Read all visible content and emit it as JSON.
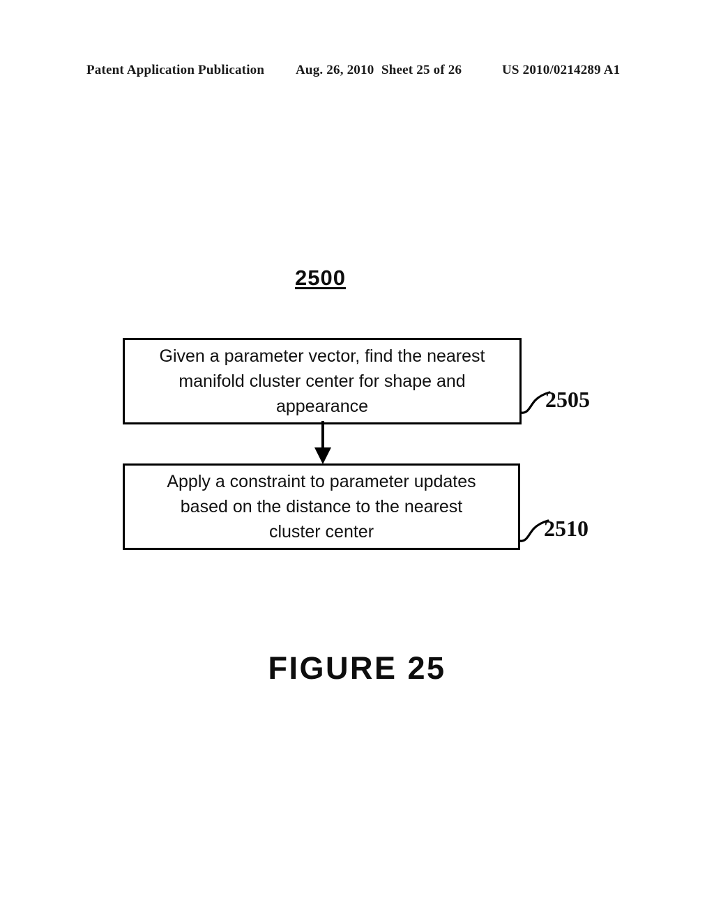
{
  "header": {
    "publication": "Patent Application Publication",
    "date": "Aug. 26, 2010",
    "sheet": "Sheet 25 of 26",
    "patent_number": "US 2010/0214289 A1"
  },
  "figure": {
    "reference_number": "2500",
    "caption": "FIGURE 25"
  },
  "flowchart": {
    "steps": [
      {
        "id": "2505",
        "text": "Given a parameter vector, find the nearest\nmanifold cluster center for shape and\nappearance",
        "callout": "2505"
      },
      {
        "id": "2510",
        "text": "Apply a constraint to parameter updates\nbased on the distance to the nearest\ncluster center",
        "callout": "2510"
      }
    ],
    "connector": {
      "type": "arrow-down",
      "from": "2505",
      "to": "2510"
    }
  },
  "colors": {
    "ink": "#000000",
    "page": "#ffffff"
  }
}
